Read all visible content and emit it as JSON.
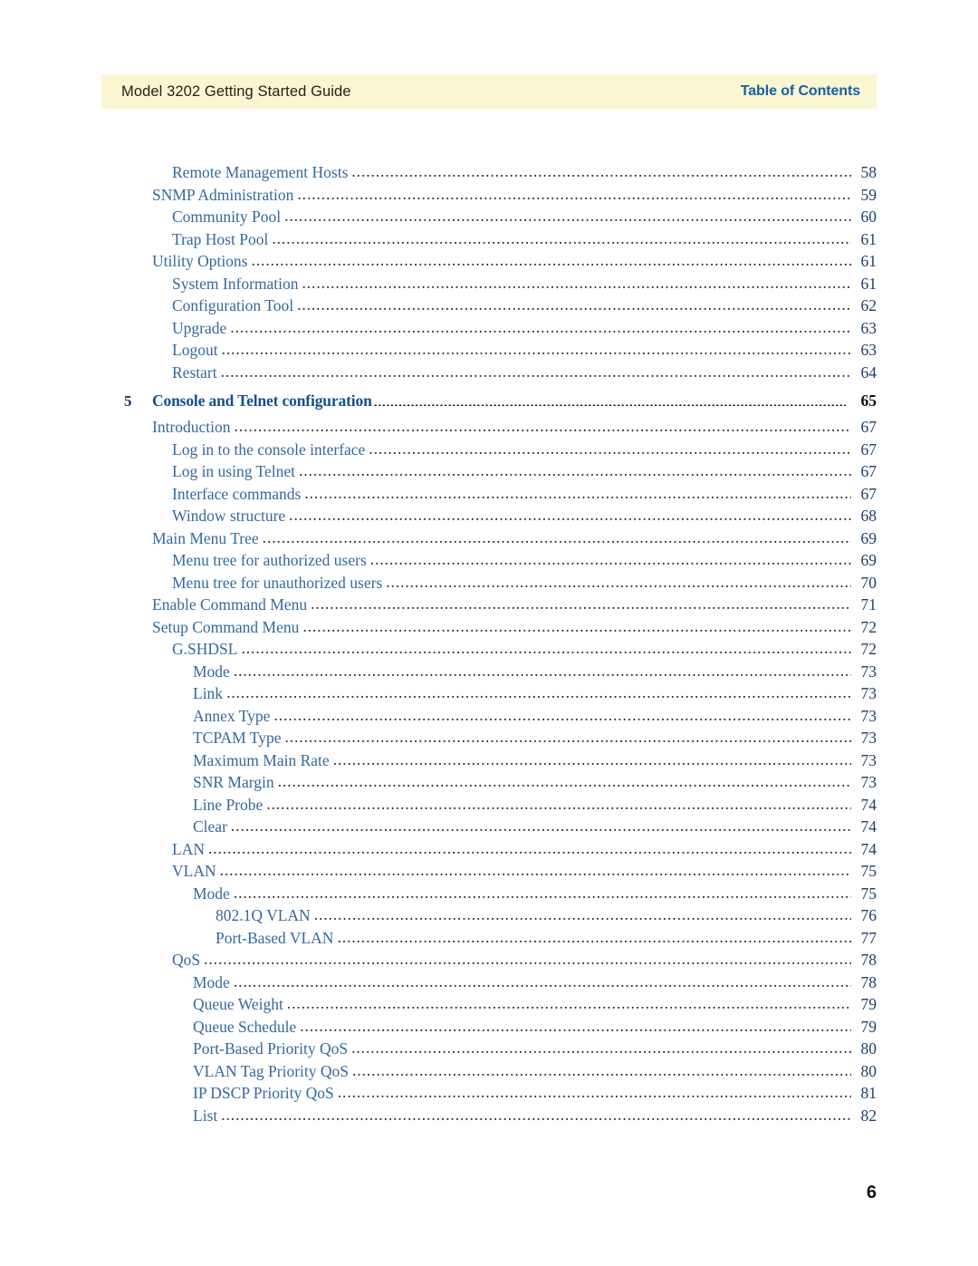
{
  "header": {
    "left_title": "Model 3202 Getting Started Guide",
    "right_title": "Table of Contents",
    "band_color": "#fbf6d2",
    "right_title_color": "#1560a8"
  },
  "folio": {
    "page_number": "6"
  },
  "colors": {
    "entry_text": "#35699f",
    "chapter_text": "#15508f",
    "leader": "#2b2b2b",
    "page_number": "#1c3f6b"
  },
  "toc": {
    "entries": [
      {
        "level": 2,
        "label": "Remote Management Hosts",
        "page": "58",
        "chapter": false
      },
      {
        "level": 1,
        "label": "SNMP Administration",
        "page": "59",
        "chapter": false
      },
      {
        "level": 2,
        "label": "Community Pool",
        "page": "60",
        "chapter": false
      },
      {
        "level": 2,
        "label": "Trap Host Pool",
        "page": "61",
        "chapter": false
      },
      {
        "level": 1,
        "label": "Utility Options",
        "page": "61",
        "chapter": false
      },
      {
        "level": 2,
        "label": "System Information",
        "page": "61",
        "chapter": false
      },
      {
        "level": 2,
        "label": "Configuration Tool",
        "page": "62",
        "chapter": false
      },
      {
        "level": 2,
        "label": "Upgrade",
        "page": "63",
        "chapter": false
      },
      {
        "level": 2,
        "label": "Logout",
        "page": "63",
        "chapter": false
      },
      {
        "level": 2,
        "label": "Restart",
        "page": "64",
        "chapter": false
      },
      {
        "level": 0,
        "number": "5",
        "label": "Console and Telnet configuration",
        "page": "65",
        "chapter": true
      },
      {
        "level": 1,
        "label": "Introduction",
        "page": "67",
        "chapter": false
      },
      {
        "level": 2,
        "label": "Log in to the console interface",
        "page": "67",
        "chapter": false
      },
      {
        "level": 2,
        "label": "Log in using Telnet",
        "page": "67",
        "chapter": false
      },
      {
        "level": 2,
        "label": "Interface commands",
        "page": "67",
        "chapter": false
      },
      {
        "level": 2,
        "label": "Window structure",
        "page": "68",
        "chapter": false
      },
      {
        "level": 1,
        "label": "Main Menu Tree",
        "page": "69",
        "chapter": false
      },
      {
        "level": 2,
        "label": "Menu tree for authorized users",
        "page": "69",
        "chapter": false
      },
      {
        "level": 2,
        "label": "Menu tree for unauthorized users",
        "page": "70",
        "chapter": false
      },
      {
        "level": 1,
        "label": "Enable Command Menu",
        "page": "71",
        "chapter": false
      },
      {
        "level": 1,
        "label": "Setup Command Menu",
        "page": "72",
        "chapter": false
      },
      {
        "level": 2,
        "label": "G.SHDSL",
        "page": "72",
        "chapter": false
      },
      {
        "level": 3,
        "label": "Mode",
        "page": "73",
        "chapter": false
      },
      {
        "level": 3,
        "label": "Link",
        "page": "73",
        "chapter": false
      },
      {
        "level": 3,
        "label": "Annex Type",
        "page": "73",
        "chapter": false
      },
      {
        "level": 3,
        "label": "TCPAM Type",
        "page": "73",
        "chapter": false
      },
      {
        "level": 3,
        "label": "Maximum Main Rate",
        "page": "73",
        "chapter": false
      },
      {
        "level": 3,
        "label": "SNR Margin",
        "page": "73",
        "chapter": false
      },
      {
        "level": 3,
        "label": "Line Probe",
        "page": "74",
        "chapter": false
      },
      {
        "level": 3,
        "label": "Clear",
        "page": "74",
        "chapter": false
      },
      {
        "level": 2,
        "label": "LAN",
        "page": "74",
        "chapter": false
      },
      {
        "level": 2,
        "label": "VLAN",
        "page": "75",
        "chapter": false
      },
      {
        "level": 3,
        "label": "Mode",
        "page": "75",
        "chapter": false
      },
      {
        "level": 4,
        "label": "802.1Q VLAN",
        "page": "76",
        "chapter": false
      },
      {
        "level": 4,
        "label": "Port-Based VLAN",
        "page": "77",
        "chapter": false
      },
      {
        "level": 2,
        "label": "QoS",
        "page": "78",
        "chapter": false
      },
      {
        "level": 3,
        "label": "Mode",
        "page": "78",
        "chapter": false
      },
      {
        "level": 3,
        "label": "Queue Weight",
        "page": "79",
        "chapter": false
      },
      {
        "level": 3,
        "label": "Queue Schedule",
        "page": "79",
        "chapter": false
      },
      {
        "level": 3,
        "label": "Port-Based Priority QoS",
        "page": "80",
        "chapter": false
      },
      {
        "level": 3,
        "label": "VLAN Tag Priority QoS",
        "page": "80",
        "chapter": false
      },
      {
        "level": 3,
        "label": "IP DSCP Priority QoS",
        "page": "81",
        "chapter": false
      },
      {
        "level": 3,
        "label": "List",
        "page": "82",
        "chapter": false
      }
    ]
  }
}
